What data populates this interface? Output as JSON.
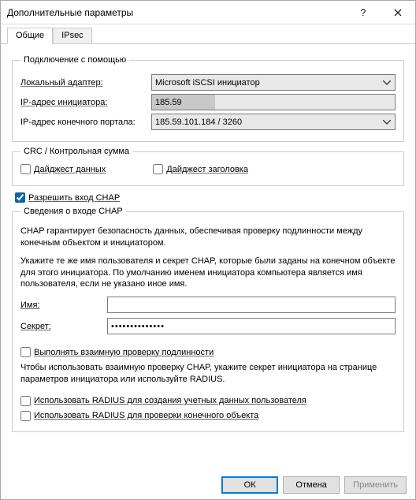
{
  "titlebar": {
    "title": "Дополнительные параметры"
  },
  "tabs": {
    "general": "Общие",
    "ipsec": "IPsec"
  },
  "connect": {
    "legend": "Подключение с помощью",
    "adapter_label": "Локальный адаптер:",
    "adapter_value": "Microsoft iSCSI инициатор",
    "initiator_ip_label": "IP-адрес инициатора:",
    "initiator_ip_value": "185.59",
    "portal_ip_label": "IP-адрес конечного портала:",
    "portal_ip_value": "185.59.101.184 / 3260"
  },
  "crc": {
    "legend": "CRC / Контрольная сумма",
    "data_digest": "Дайджест данных",
    "header_digest": "Дайджест заголовка"
  },
  "chap": {
    "allow_label": "Разрешить вход CHAP",
    "legend": "Сведения о входе CHAP",
    "desc1": "CHAP гарантирует безопасность данных, обеспечивая проверку подлинности между конечным объектом и инициатором.",
    "desc2": "Укажите те же имя пользователя и секрет CHAP, которые были заданы на конечном объекте для этого инициатора. По умолчанию именем инициатора компьютера является имя пользователя, если не указано иное имя.",
    "name_label": "Имя:",
    "name_value": "",
    "secret_label": "Секрет:",
    "secret_value": "••••••••••••••",
    "mutual_label": "Выполнять взаимную проверку подлинности",
    "mutual_desc": "Чтобы использовать взаимную проверку CHAP, укажите секрет инициатора на странице параметров инициатора или используйте RADIUS.",
    "radius_creds": "Использовать RADIUS для создания учетных данных пользователя",
    "radius_auth": "Использовать RADIUS для проверки конечного объекта"
  },
  "buttons": {
    "ok": "ОК",
    "cancel": "Отмена",
    "apply": "Применить"
  }
}
